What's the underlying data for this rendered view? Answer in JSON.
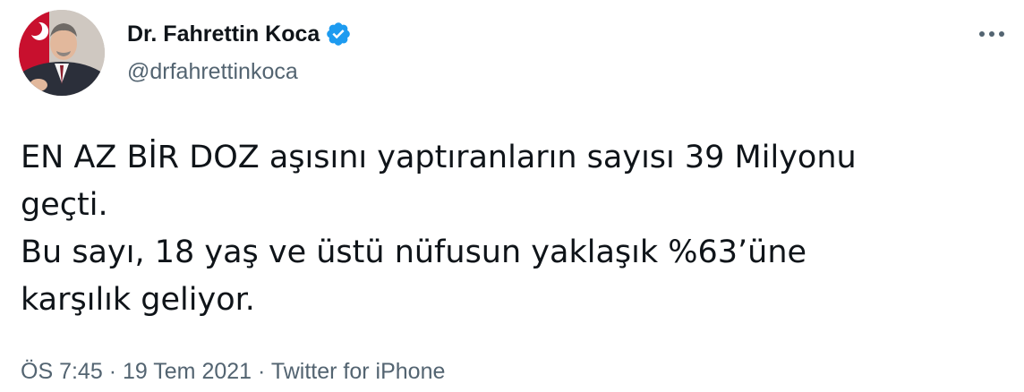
{
  "author": {
    "display_name": "Dr. Fahrettin Koca",
    "handle": "@drfahrettinkoca",
    "verified_icon": "verified-badge-icon",
    "accent_color": "#1d9bf0"
  },
  "more_icon": "more-horizontal-icon",
  "tweet": {
    "lines": [
      "EN AZ BİR DOZ aşısını yaptıranların sayısı 39 Milyonu",
      "geçti.",
      "Bu sayı, 18 yaş ve üstü nüfusun yaklaşık %63’üne",
      "karşılık geliyor."
    ]
  },
  "meta": {
    "time": "ÖS 7:45",
    "separator": "·",
    "date": "19 Tem 2021",
    "source": "Twitter for iPhone"
  }
}
